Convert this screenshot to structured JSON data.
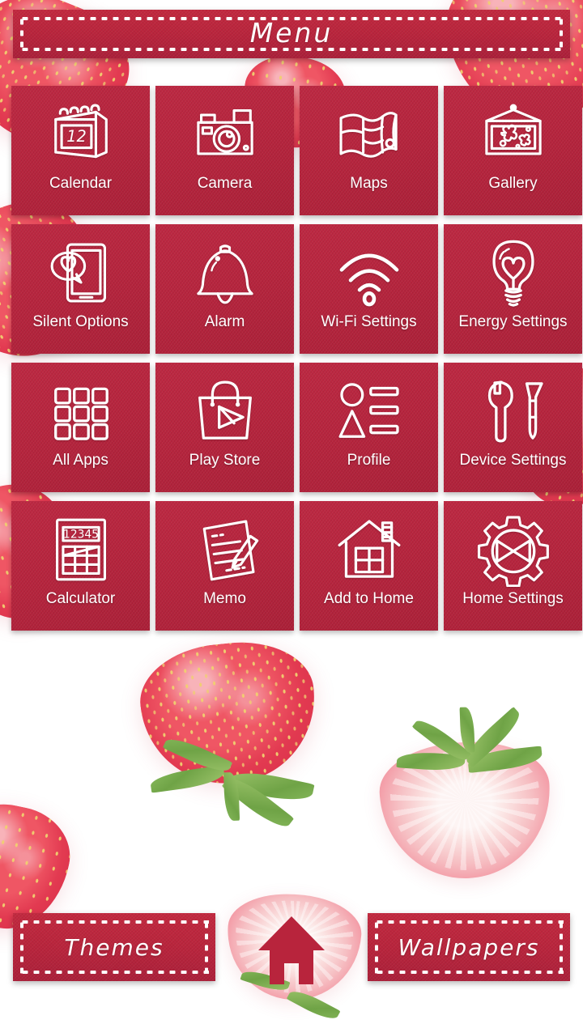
{
  "header": {
    "title": "Menu"
  },
  "grid": {
    "tiles": [
      {
        "label": "Calendar",
        "icon": "calendar-icon",
        "day": "12"
      },
      {
        "label": "Camera",
        "icon": "camera-icon"
      },
      {
        "label": "Maps",
        "icon": "map-icon"
      },
      {
        "label": "Gallery",
        "icon": "picture-frame-icon"
      },
      {
        "label": "Silent Options",
        "icon": "phone-heart-bubble-icon"
      },
      {
        "label": "Alarm",
        "icon": "bell-icon"
      },
      {
        "label": "Wi-Fi Settings",
        "icon": "wifi-icon"
      },
      {
        "label": "Energy Settings",
        "icon": "lightbulb-heart-icon"
      },
      {
        "label": "All Apps",
        "icon": "app-grid-icon"
      },
      {
        "label": "Play Store",
        "icon": "shopping-bag-play-icon"
      },
      {
        "label": "Profile",
        "icon": "person-list-icon"
      },
      {
        "label": "Device Settings",
        "icon": "wrench-screwdriver-icon"
      },
      {
        "label": "Calculator",
        "icon": "calculator-icon",
        "display": "12345"
      },
      {
        "label": "Memo",
        "icon": "note-pencil-icon"
      },
      {
        "label": "Add to Home",
        "icon": "house-icon"
      },
      {
        "label": "Home Settings",
        "icon": "gear-bowtie-icon"
      }
    ]
  },
  "bottom_bar": {
    "themes_label": "Themes",
    "wallpapers_label": "Wallpapers",
    "home_icon": "home-icon"
  },
  "colors": {
    "tile_red": "#b6243d",
    "ribbon_red": "#b8243c",
    "icon_white": "#ffffff",
    "background": "#ffffff",
    "berry_red": "#e23a51",
    "leaf_green": "#6fa346"
  }
}
